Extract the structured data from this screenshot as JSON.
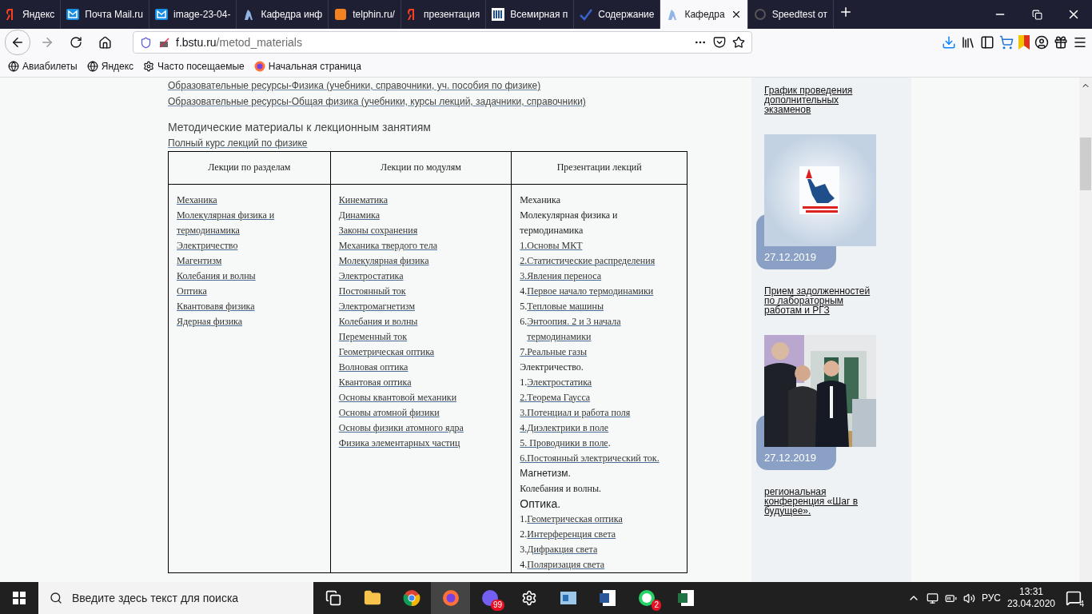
{
  "browser": {
    "tabs": [
      {
        "title": "Яндекс",
        "selected": false
      },
      {
        "title": "Почта Mail.ru",
        "selected": false
      },
      {
        "title": "image-23-04-",
        "selected": false
      },
      {
        "title": "Кафедра инф",
        "selected": false
      },
      {
        "title": "telphin.ru/",
        "selected": false
      },
      {
        "title": "презентация",
        "selected": false
      },
      {
        "title": "Всемирная п",
        "selected": false
      },
      {
        "title": "Содержание",
        "selected": false
      },
      {
        "title": "Кафедра",
        "selected": true
      },
      {
        "title": "Speedtest от",
        "selected": false
      }
    ],
    "url_host": "f.bstu.ru",
    "url_path": "/metod_materials",
    "bookmarks": [
      "Авиабилеты",
      "Яндекс",
      "Часто посещаемые",
      "Начальная страница"
    ]
  },
  "page": {
    "resource_links": [
      "Образовательные ресурсы-Физика (учебники, справочники, уч. пособия по физике)",
      "Образовательные ресурсы-Общая физика (учебники, курсы лекций, задачники, справочники)"
    ],
    "section_title": "Методические материалы к лекционным занятиям",
    "full_course_link": "Полный курс лекций по физике",
    "table": {
      "columns": [
        "Лекции по разделам",
        "Лекции по модулям",
        "Презентации лекций"
      ],
      "column_1": [
        "Механика",
        "Молекулярная физика и термодинамика",
        "Электричество",
        "Магентизм",
        "Колебания и волны",
        "Оптика",
        "Квантовавя физика",
        "Ядерная физика"
      ],
      "column_2": [
        "Кинематика",
        "Динамика",
        "Законы сохранения",
        "Механика твердого тела",
        "Молекулярная физика",
        "Электростатика",
        "Постоянный ток",
        "Электромагнетизм",
        "Колебания и волны",
        "Переменный ток",
        "Геометрическая оптика",
        "Волновая оптика",
        "Квантовая оптика",
        "Основы квантовой механики",
        "Основы атомной физики",
        "Основы физики атомного ядра",
        "Физика элементарных частиц"
      ],
      "column_3": [
        {
          "kind": "plain",
          "text": "Механика"
        },
        {
          "kind": "plain",
          "text": "Молекулярная физика и термодинамика"
        },
        {
          "kind": "link",
          "link": "1.Основы МКТ"
        },
        {
          "kind": "link",
          "link": "2.Статистические распределения"
        },
        {
          "kind": "link",
          "link": "3.Явления переноса"
        },
        {
          "kind": "numbered",
          "prefix": "4.",
          "link": "Первое начало термодинамики"
        },
        {
          "kind": "numbered",
          "prefix": "5.",
          "link": "Тепловые машины"
        },
        {
          "kind": "numbered",
          "prefix": "6.",
          "link": "Энтоопия. 2 и 3 начала термодинамики"
        },
        {
          "kind": "link",
          "link": "7.Реальные газы"
        },
        {
          "kind": "plain",
          "text": "Электричество."
        },
        {
          "kind": "numbered",
          "prefix": "1.",
          "link": "Электростатика"
        },
        {
          "kind": "link",
          "link": "2.Теорема Гаусса"
        },
        {
          "kind": "link",
          "link": "3.Потенциал и работа поля"
        },
        {
          "kind": "link",
          "link": "4.Диэлектрики в поле"
        },
        {
          "kind": "suffixed",
          "link": "5. Проводники в поле",
          "suffix": "."
        },
        {
          "kind": "link",
          "link": "6.Постоянный электрический ток."
        },
        {
          "kind": "sans",
          "text": "Магнетизм."
        },
        {
          "kind": "plain",
          "text": "Колебания и волны."
        },
        {
          "kind": "sans-large",
          "text": "Оптика."
        },
        {
          "kind": "numbered",
          "prefix": "1.",
          "link": "Геометрическая оптика"
        },
        {
          "kind": "numbered",
          "prefix": "2.",
          "link": "Интерференция света"
        },
        {
          "kind": "numbered",
          "prefix": "3.",
          "link": "Дифракция света"
        },
        {
          "kind": "numbered",
          "prefix": "4.",
          "link": "Поляризация света"
        }
      ]
    }
  },
  "sidebar": [
    {
      "kind": "link",
      "text": "График проведения дополнительных экзаменов"
    },
    {
      "kind": "picture",
      "date": "27.12.2019"
    },
    {
      "kind": "link",
      "text": "Прием задолженностей по лабораторным работам и РГЗ"
    },
    {
      "kind": "picture",
      "date": "27.12.2019"
    },
    {
      "kind": "link",
      "text": "региональная конференция «Шаг в будущее»."
    }
  ],
  "taskbar": {
    "search_placeholder": "Введите здесь текст для поиска",
    "apps": [
      {
        "selected": false
      },
      {
        "selected": false
      },
      {
        "selected": false
      },
      {
        "selected": true
      },
      {
        "badge": "99",
        "selected": false
      },
      {
        "selected": false
      },
      {
        "selected": false
      },
      {
        "selected": false
      },
      {
        "badge": "2",
        "selected": false
      },
      {
        "selected": false
      }
    ],
    "language": "РУС",
    "time": "13:31",
    "date": "23.04.2020",
    "notifications": "4"
  }
}
